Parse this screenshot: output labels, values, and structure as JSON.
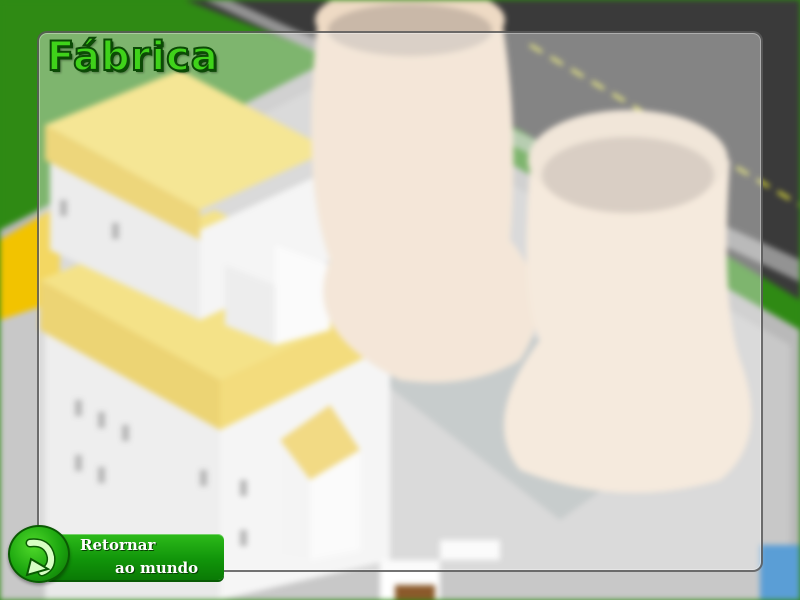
{
  "screen": {
    "title": "Fábrica",
    "back_button": {
      "line1": "Retornar",
      "line2": "ao mundo",
      "icon": "return-arrow-icon"
    }
  },
  "colors": {
    "grass": "#2f8a14",
    "road": "#3a3a3a",
    "title_fill": "#3fd21a",
    "title_outline": "#0c4a06",
    "button_green": "#11950a"
  }
}
